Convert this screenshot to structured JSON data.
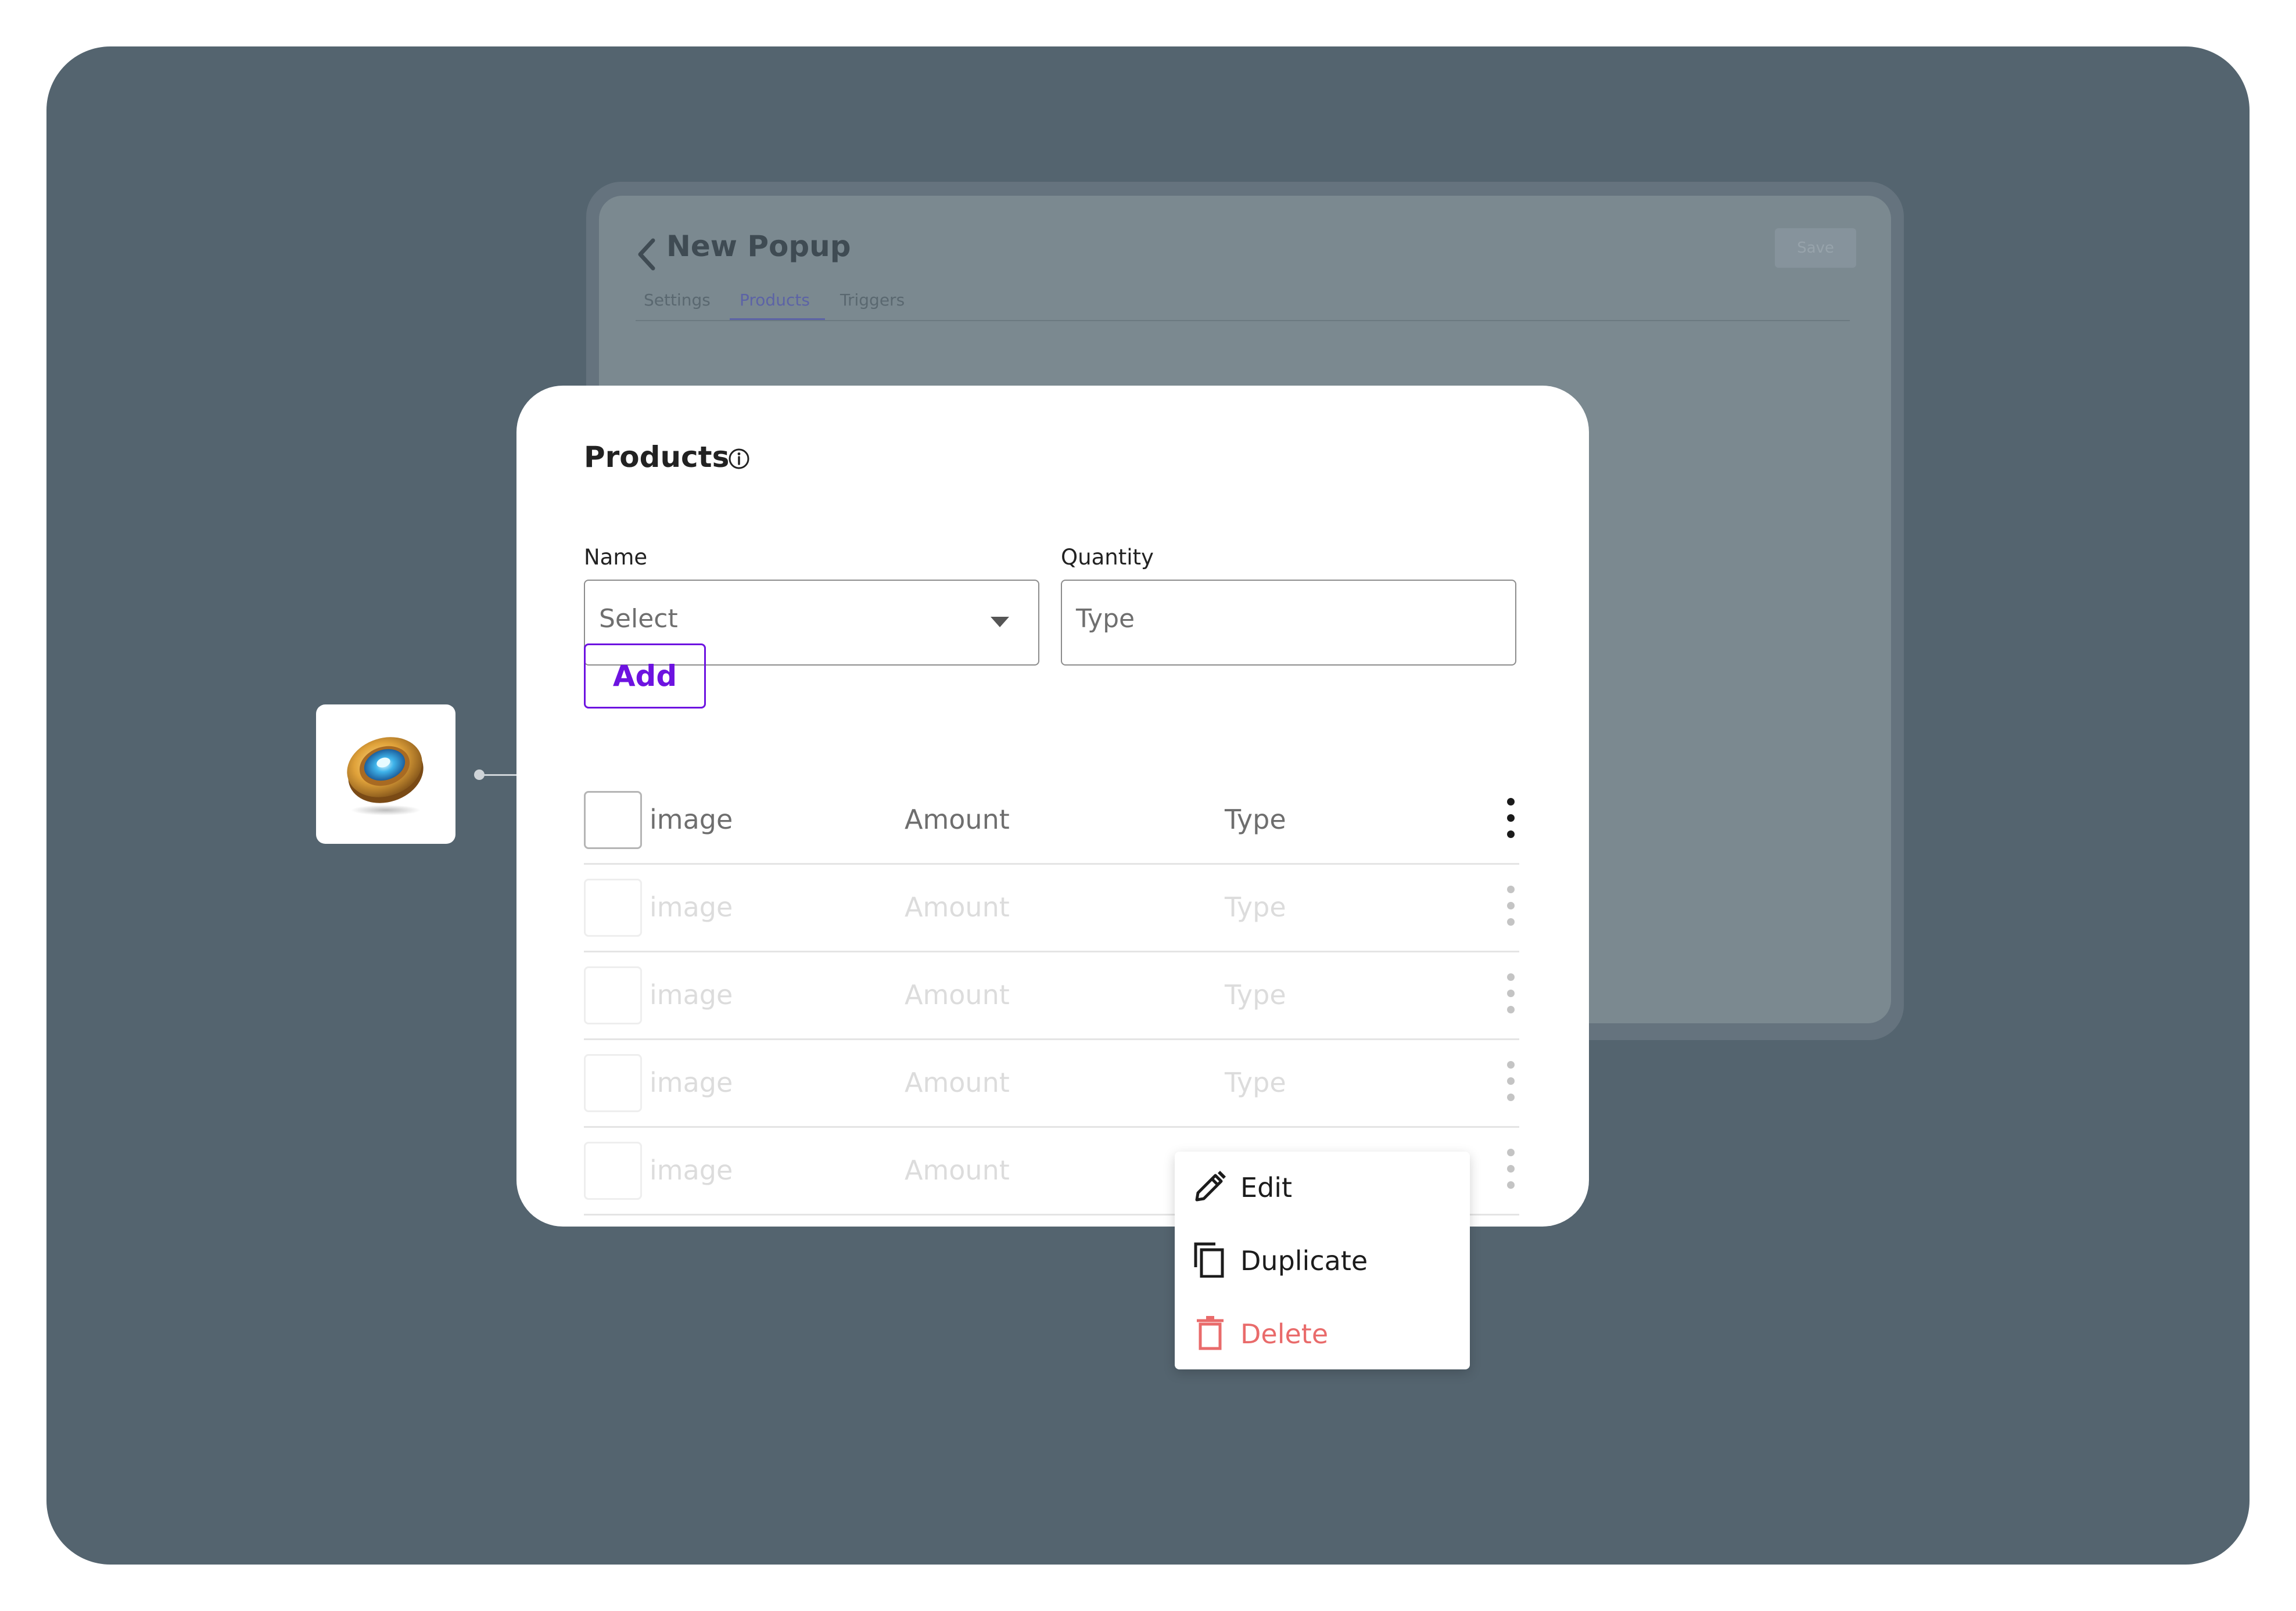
{
  "background_window": {
    "title": "New Popup",
    "tabs": [
      "Settings",
      "Products",
      "Triggers"
    ],
    "active_tab": "Products",
    "save_label": "Save"
  },
  "card": {
    "title": "Products",
    "name_label": "Name",
    "name_placeholder": "Select",
    "quantity_label": "Quantity",
    "quantity_placeholder": "Type",
    "add_label": "Add",
    "rows": [
      {
        "c1": "image",
        "c2": "Amount",
        "c3": "Type"
      },
      {
        "c1": "image",
        "c2": "Amount",
        "c3": "Type"
      },
      {
        "c1": "image",
        "c2": "Amount",
        "c3": "Type"
      },
      {
        "c1": "image",
        "c2": "Amount",
        "c3": "Type"
      },
      {
        "c1": "image",
        "c2": "Amount",
        "c3": ""
      }
    ]
  },
  "context_menu": {
    "items": [
      {
        "label": "Edit",
        "icon": "pencil-icon"
      },
      {
        "label": "Duplicate",
        "icon": "duplicate-icon"
      },
      {
        "label": "Delete",
        "icon": "trash-icon",
        "color": "#e96b6b"
      }
    ]
  },
  "colors": {
    "accent": "#6d13e0",
    "danger": "#e96b6b",
    "backdrop": "#54646f"
  }
}
